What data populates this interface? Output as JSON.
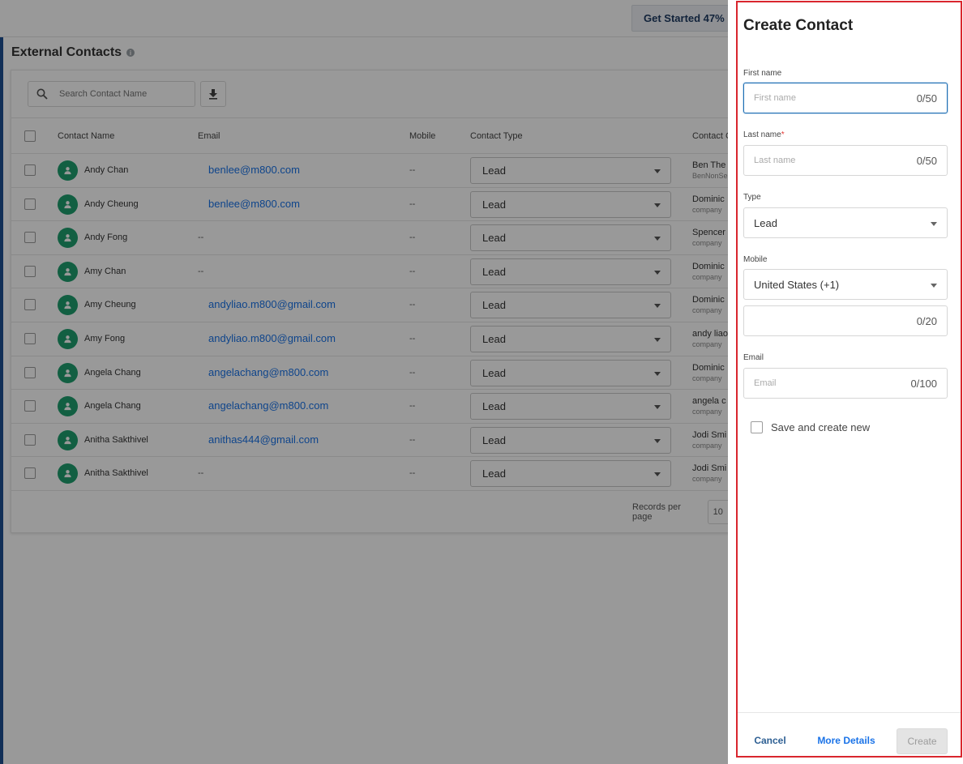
{
  "topbar": {
    "get_started": "Get Started 47%"
  },
  "page": {
    "title": "External Contacts",
    "info_icon": "info-icon"
  },
  "toolbar": {
    "search_placeholder": "Search Contact Name",
    "download_icon": "download-icon"
  },
  "table": {
    "headers": {
      "name": "Contact Name",
      "email": "Email",
      "mobile": "Mobile",
      "type": "Contact Type",
      "company": "Contact C"
    },
    "rows": [
      {
        "name": "Andy Chan",
        "email": "benlee@m800.com",
        "mobile": "--",
        "type": "Lead",
        "company": "Ben The",
        "company_sub": "BenNonSe"
      },
      {
        "name": "Andy Cheung",
        "email": "benlee@m800.com",
        "mobile": "--",
        "type": "Lead",
        "company": "Dominic",
        "company_sub": "company"
      },
      {
        "name": "Andy Fong",
        "email": "--",
        "mobile": "--",
        "type": "Lead",
        "company": "Spencer",
        "company_sub": "company"
      },
      {
        "name": "Amy Chan",
        "email": "--",
        "mobile": "--",
        "type": "Lead",
        "company": "Dominic",
        "company_sub": "company"
      },
      {
        "name": "Amy Cheung",
        "email": "andyliao.m800@gmail.com",
        "mobile": "--",
        "type": "Lead",
        "company": "Dominic",
        "company_sub": "company"
      },
      {
        "name": "Amy Fong",
        "email": "andyliao.m800@gmail.com",
        "mobile": "--",
        "type": "Lead",
        "company": "andy liao",
        "company_sub": "company"
      },
      {
        "name": "Angela Chang",
        "email": "angelachang@m800.com",
        "mobile": "--",
        "type": "Lead",
        "company": "Dominic",
        "company_sub": "company"
      },
      {
        "name": "Angela Chang",
        "email": "angelachang@m800.com",
        "mobile": "--",
        "type": "Lead",
        "company": "angela c",
        "company_sub": "company"
      },
      {
        "name": "Anitha Sakthivel",
        "email": "anithas444@gmail.com",
        "mobile": "--",
        "type": "Lead",
        "company": "Jodi Smi",
        "company_sub": "company"
      },
      {
        "name": "Anitha Sakthivel",
        "email": "--",
        "mobile": "--",
        "type": "Lead",
        "company": "Jodi Smi",
        "company_sub": "company"
      }
    ]
  },
  "pager": {
    "label": "Records per page",
    "value": "10"
  },
  "drawer": {
    "title": "Create Contact",
    "first_name": {
      "label": "First name",
      "placeholder": "First name",
      "counter": "0/50"
    },
    "last_name": {
      "label": "Last name",
      "required_mark": "*",
      "placeholder": "Last name",
      "counter": "0/50"
    },
    "type": {
      "label": "Type",
      "value": "Lead"
    },
    "mobile": {
      "label": "Mobile",
      "country": "United States (+1)",
      "counter": "0/20"
    },
    "email": {
      "label": "Email",
      "placeholder": "Email",
      "counter": "0/100"
    },
    "save_new": "Save and create new",
    "cancel": "Cancel",
    "more_details": "More Details",
    "create": "Create"
  },
  "colors": {
    "accent": "#1a73e8",
    "highlight_border": "#d9262e",
    "avatar": "#1f9e6e"
  }
}
